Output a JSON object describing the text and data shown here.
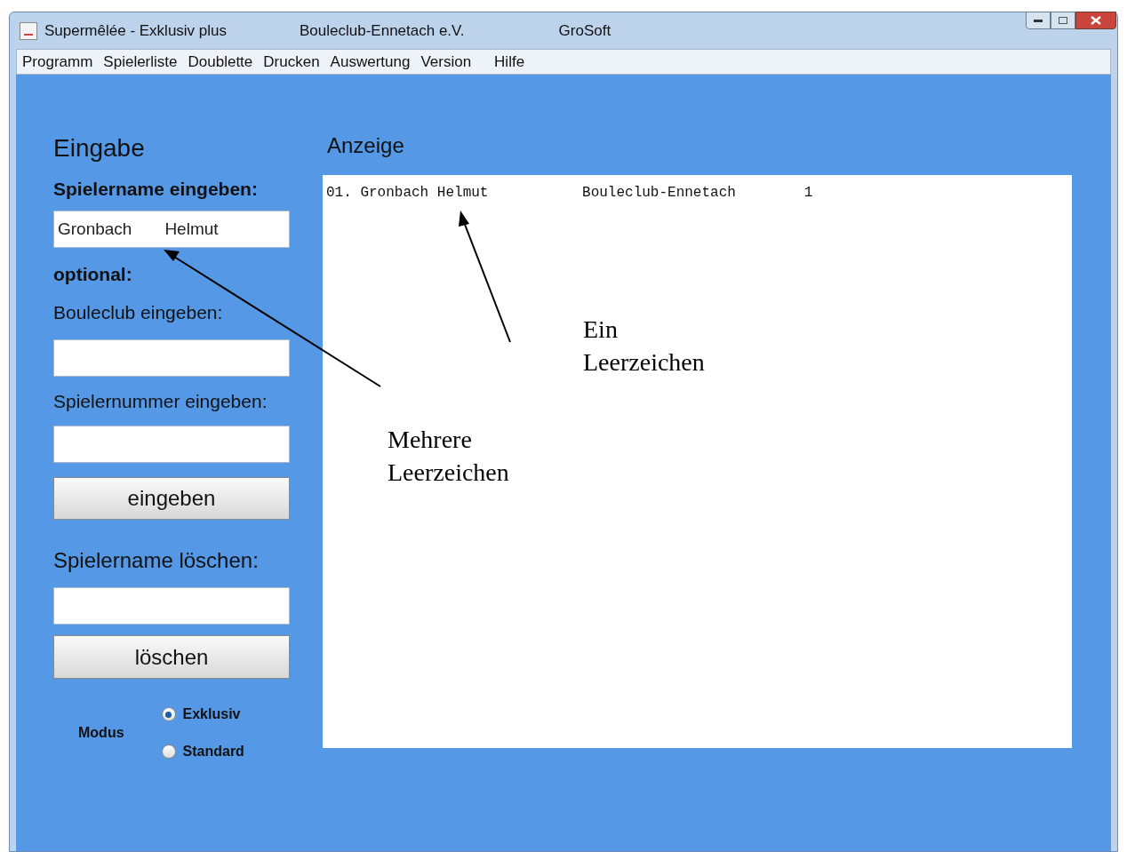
{
  "window": {
    "title_parts": [
      "Supermêlée - Exklusiv plus",
      "Bouleclub-Ennetach e.V.",
      "GroSoft"
    ]
  },
  "menu": [
    "Programm",
    "Spielerliste",
    "Doublette",
    "Drucken",
    "Auswertung",
    "Version",
    "Hilfe"
  ],
  "input_panel": {
    "heading": "Eingabe",
    "name_label": "Spielername eingeben:",
    "name_value": "Gronbach       Helmut",
    "optional_label": "optional:",
    "club_label": "Bouleclub eingeben:",
    "number_label": "Spielernummer eingeben:",
    "submit_button": "eingeben",
    "delete_label": "Spielername löschen:",
    "delete_button": "löschen"
  },
  "modus": {
    "label": "Modus",
    "options": [
      {
        "label": "Exklusiv",
        "selected": true
      },
      {
        "label": "Standard",
        "selected": false
      }
    ]
  },
  "display": {
    "heading": "Anzeige",
    "rows": [
      "01. Gronbach Helmut           Bouleclub-Ennetach        1"
    ]
  },
  "annotations": [
    {
      "text": "Ein Leerzeichen"
    },
    {
      "text": "Mehrere Leerzeichen"
    }
  ]
}
